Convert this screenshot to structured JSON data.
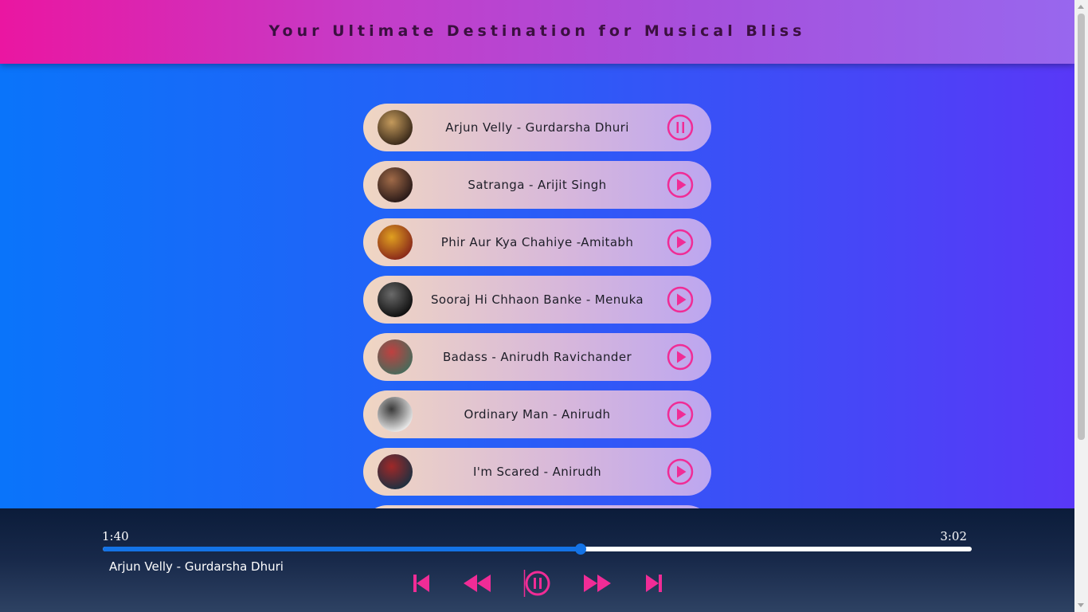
{
  "header": {
    "title": "Your Ultimate Destination for Musical Bliss"
  },
  "playlist": [
    {
      "title": "Arjun Velly - Gurdarsha Dhuri",
      "state": "pause",
      "cover_colors": [
        "#3a2a1a",
        "#c49a5c"
      ]
    },
    {
      "title": "Satranga - Arijit Singh",
      "state": "play",
      "cover_colors": [
        "#2a1a18",
        "#a06a48"
      ]
    },
    {
      "title": "Phir Aur Kya Chahiye -Amitabh",
      "state": "play",
      "cover_colors": [
        "#8a2a1a",
        "#e0a020"
      ]
    },
    {
      "title": "Sooraj Hi Chhaon Banke - Menuka",
      "state": "play",
      "cover_colors": [
        "#101010",
        "#6a6a6a"
      ]
    },
    {
      "title": "Badass - Anirudh Ravichander",
      "state": "play",
      "cover_colors": [
        "#4a6a5a",
        "#c04040"
      ]
    },
    {
      "title": "Ordinary Man - Anirudh",
      "state": "play",
      "cover_colors": [
        "#e8e8e8",
        "#3a3a3a"
      ]
    },
    {
      "title": "I'm Scared - Anirudh",
      "state": "play",
      "cover_colors": [
        "#203040",
        "#a02828"
      ]
    },
    {
      "title": "",
      "state": "play",
      "cover_colors": [
        "#444444",
        "#888888"
      ]
    }
  ],
  "player": {
    "current_time": "1:40",
    "total_time": "3:02",
    "progress": 0.55,
    "now_playing": "Arjun Velly - Gurdarsha Dhuri"
  },
  "colors": {
    "accent": "#f02c96",
    "progress_fill": "#1473e6"
  }
}
